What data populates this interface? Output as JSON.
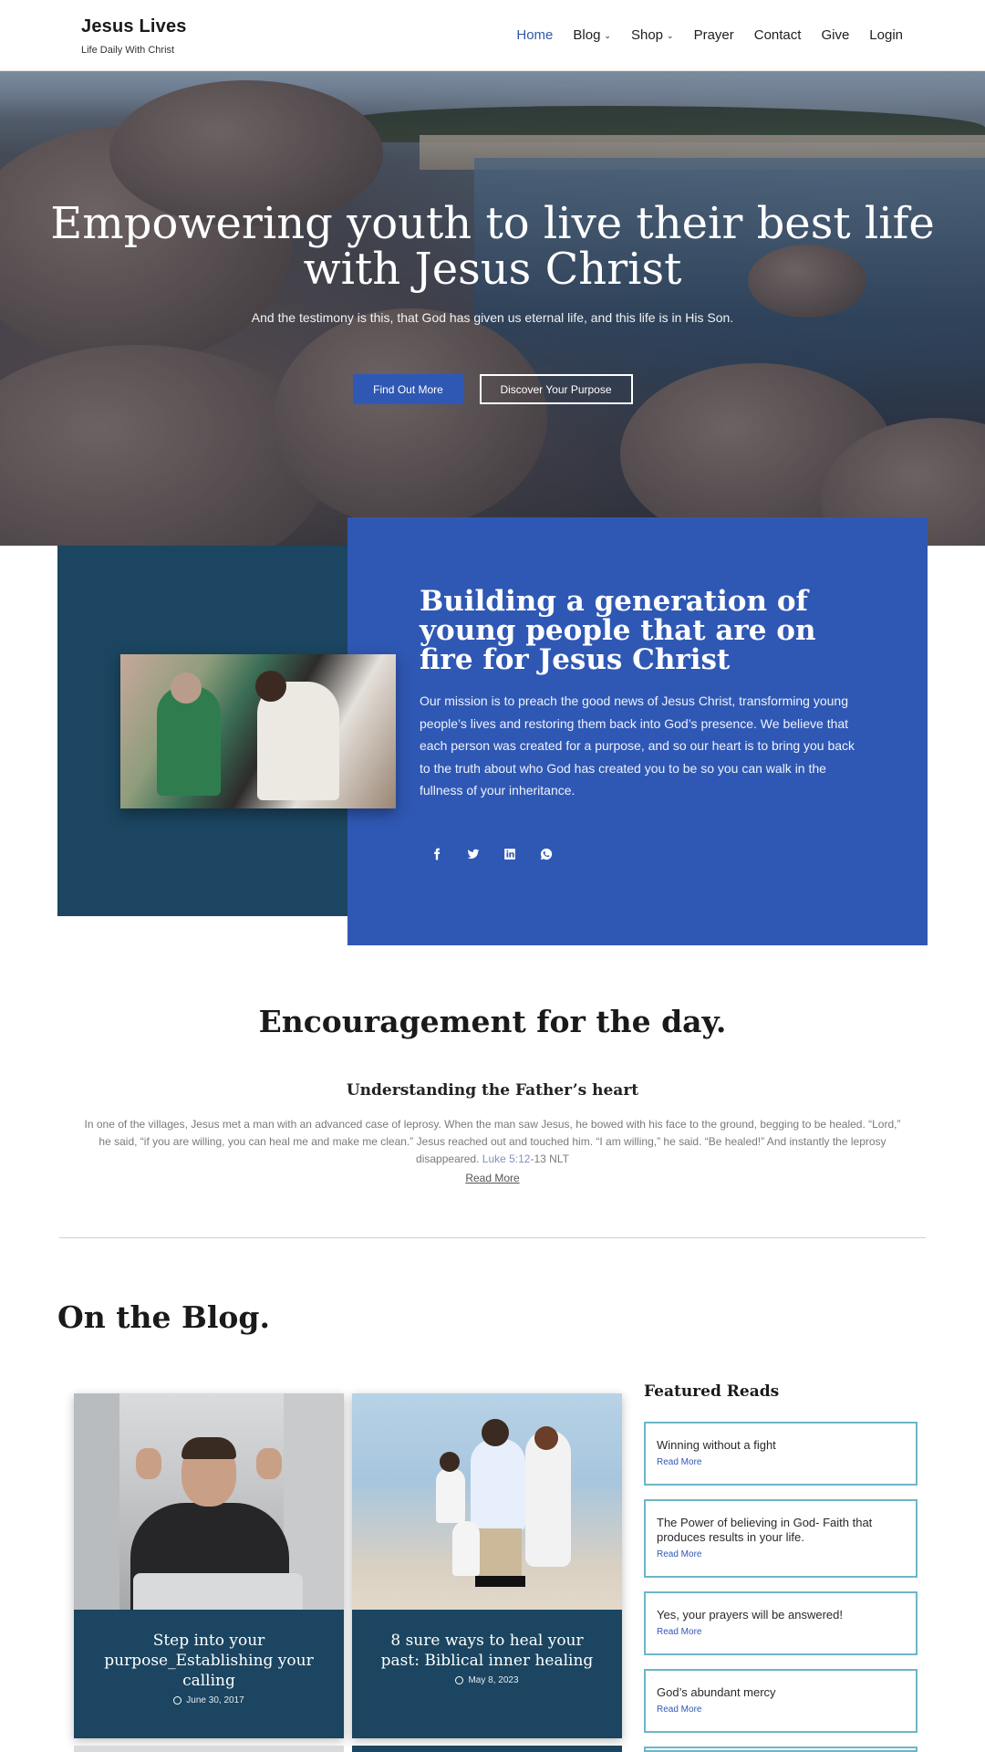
{
  "header": {
    "brand_title": "Jesus Lives",
    "brand_tagline": "Life Daily With Christ",
    "nav": [
      {
        "label": "Home",
        "active": true,
        "dropdown": false
      },
      {
        "label": "Blog",
        "active": false,
        "dropdown": true
      },
      {
        "label": "Shop",
        "active": false,
        "dropdown": true
      },
      {
        "label": "Prayer",
        "active": false,
        "dropdown": false
      },
      {
        "label": "Contact",
        "active": false,
        "dropdown": false
      },
      {
        "label": "Give",
        "active": false,
        "dropdown": false
      },
      {
        "label": "Login",
        "active": false,
        "dropdown": false
      }
    ]
  },
  "hero": {
    "title": "Empowering youth to live their best life with Jesus Christ",
    "subtitle": "And the testimony is this, that God has given us eternal life, and this life is in His Son.",
    "primary_button": "Find Out More",
    "secondary_button": "Discover Your Purpose"
  },
  "mission": {
    "title": "Building a generation of young people that are on fire for Jesus Christ",
    "text": "Our mission is to preach the good news of Jesus Christ, transforming young people’s lives and restoring them back into God’s presence. We believe that each person was created for a purpose, and so our heart is to bring you back to the truth about who God has created you to be so you can walk in the fullness of your inheritance.",
    "socials": [
      "facebook-icon",
      "twitter-icon",
      "linkedin-icon",
      "whatsapp-icon"
    ]
  },
  "encouragement": {
    "title": "Encouragement for the day.",
    "subtitle": "Understanding the Father’s heart",
    "text": "In one of the villages, Jesus met a man with an advanced case of leprosy. When the man saw Jesus, he bowed with his face to the ground, begging to be healed. “Lord,” he said, “if you are willing, you can heal me and make me clean.” Jesus reached out and touched him. “I am willing,” he said. “Be healed!” And instantly the leprosy disappeared.",
    "reference_link": "Luke 5:12",
    "reference_rest": "-13 NLT",
    "read_more": "Read More"
  },
  "blog": {
    "title": "On the Blog.",
    "posts": [
      {
        "title": "Step into your purpose_Establishing your calling",
        "date": "June 30, 2017"
      },
      {
        "title": "8 sure ways to heal your past: Biblical inner healing",
        "date": "May 8, 2023"
      }
    ]
  },
  "featured": {
    "title": "Featured Reads",
    "read_more": "Read More",
    "items": [
      {
        "title": "Winning without a fight"
      },
      {
        "title": "The Power of believing in God- Faith that produces results in your life."
      },
      {
        "title": "Yes, your prayers will be answered!"
      },
      {
        "title": "God’s abundant mercy"
      }
    ]
  },
  "colors": {
    "accent": "#2f58b4",
    "dark_teal": "#1b4560",
    "featured_border": "#6cb6c8"
  }
}
